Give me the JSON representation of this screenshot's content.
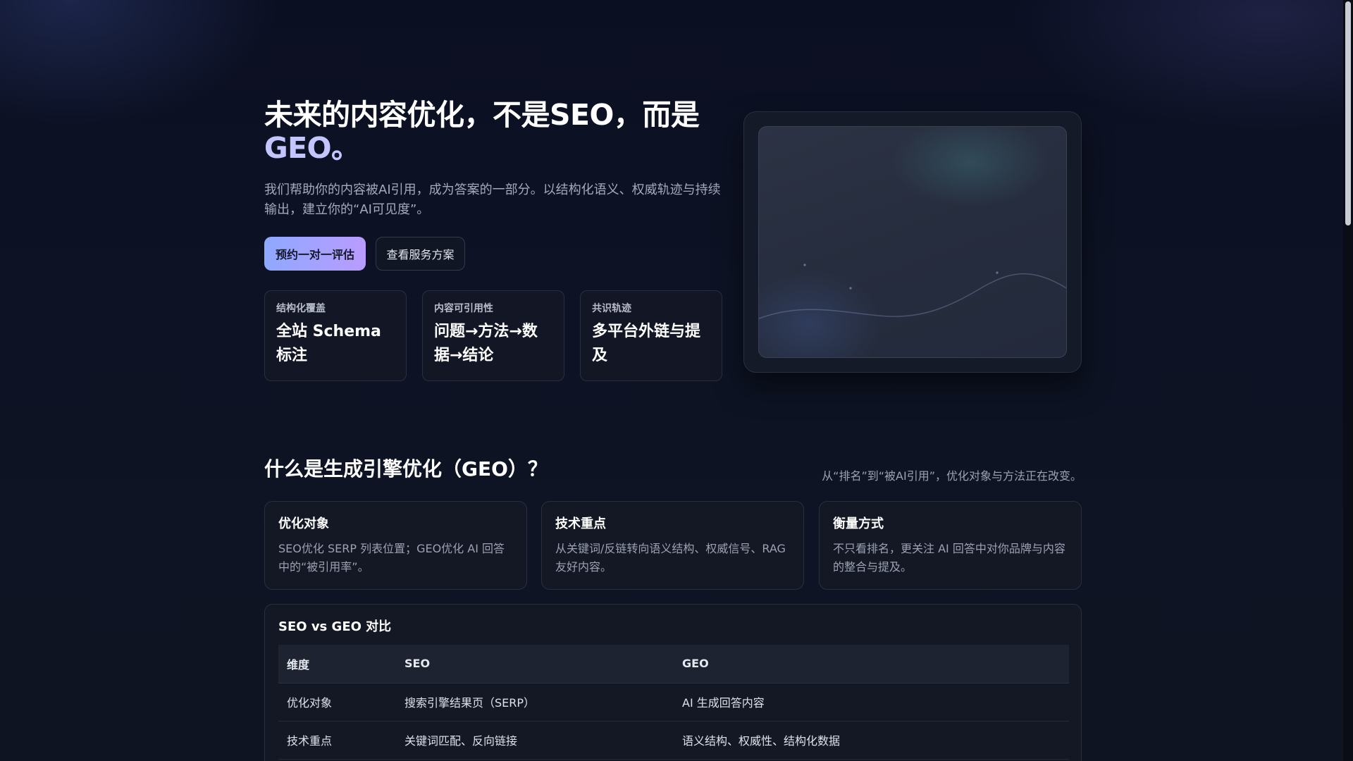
{
  "hero": {
    "title_main": "未来的内容优化，不是SEO，而是",
    "title_accent": "GEO。",
    "subtitle": "我们帮助你的内容被AI引用，成为答案的一部分。以结构化语义、权威轨迹与持续输出，建立你的“AI可见度”。",
    "primary_button": "预约一对一评估",
    "secondary_button": "查看服务方案",
    "stats": [
      {
        "label": "结构化覆盖",
        "value": "全站 Schema 标注"
      },
      {
        "label": "内容可引用性",
        "value": "问题→方法→数据→结论"
      },
      {
        "label": "共识轨迹",
        "value": "多平台外链与提及"
      }
    ]
  },
  "section": {
    "title": "什么是生成引擎优化（GEO）？",
    "note": "从“排名”到“被AI引用”，优化对象与方法正在改变。",
    "cards": [
      {
        "title": "优化对象",
        "desc": "SEO优化 SERP 列表位置；GEO优化 AI 回答中的“被引用率”。"
      },
      {
        "title": "技术重点",
        "desc": "从关键词/反链转向语义结构、权威信号、RAG 友好内容。"
      },
      {
        "title": "衡量方式",
        "desc": "不只看排名，更关注 AI 回答中对你品牌与内容的整合与提及。"
      }
    ]
  },
  "comparison": {
    "title": "SEO vs GEO 对比",
    "headers": [
      "维度",
      "SEO",
      "GEO"
    ],
    "rows": [
      [
        "优化对象",
        "搜索引擎结果页（SERP）",
        "AI 生成回答内容"
      ],
      [
        "技术重点",
        "关键词匹配、反向链接",
        "语义结构、权威性、结构化数据"
      ]
    ]
  },
  "colors": {
    "accent_gradient_start": "#8fa8ff",
    "accent_gradient_end": "#b99cff",
    "background": "#0d1324"
  }
}
